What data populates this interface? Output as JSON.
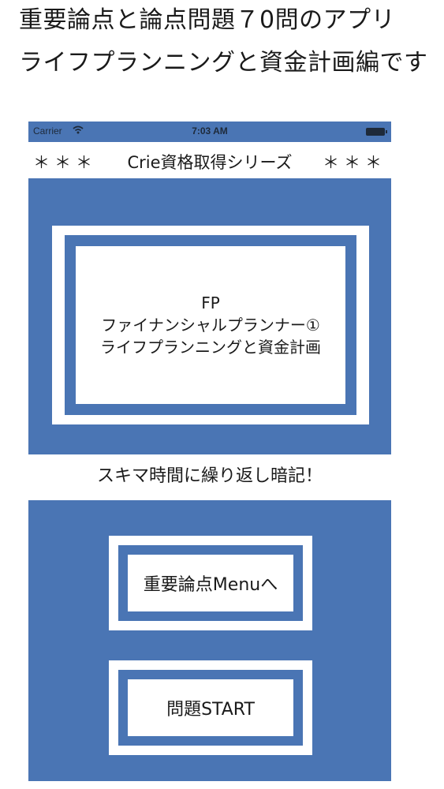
{
  "caption": {
    "line1": "重要論点と論点問題７0問のアプリ",
    "line2": "ライフプランニングと資金計画編です"
  },
  "status_bar": {
    "carrier": "Carrier",
    "time": "7:03 AM",
    "wifi_icon": "wifi-icon",
    "battery_icon": "battery-icon"
  },
  "series": {
    "stars_left": "＊＊＊",
    "title": "Crie資格取得シリーズ",
    "stars_right": "＊＊＊"
  },
  "app_title": {
    "line1": "FP",
    "line2": "ファイナンシャルプランナー①",
    "line3": "ライフプランニングと資金計画"
  },
  "catchphrase": "スキマ時間に繰り返し暗記！",
  "buttons": {
    "important_menu": "重要論点Menuへ",
    "start_quiz": "問題START"
  },
  "colors": {
    "accent_blue": "#4a75b4",
    "background": "#ffffff",
    "text": "#1a1a1a"
  }
}
